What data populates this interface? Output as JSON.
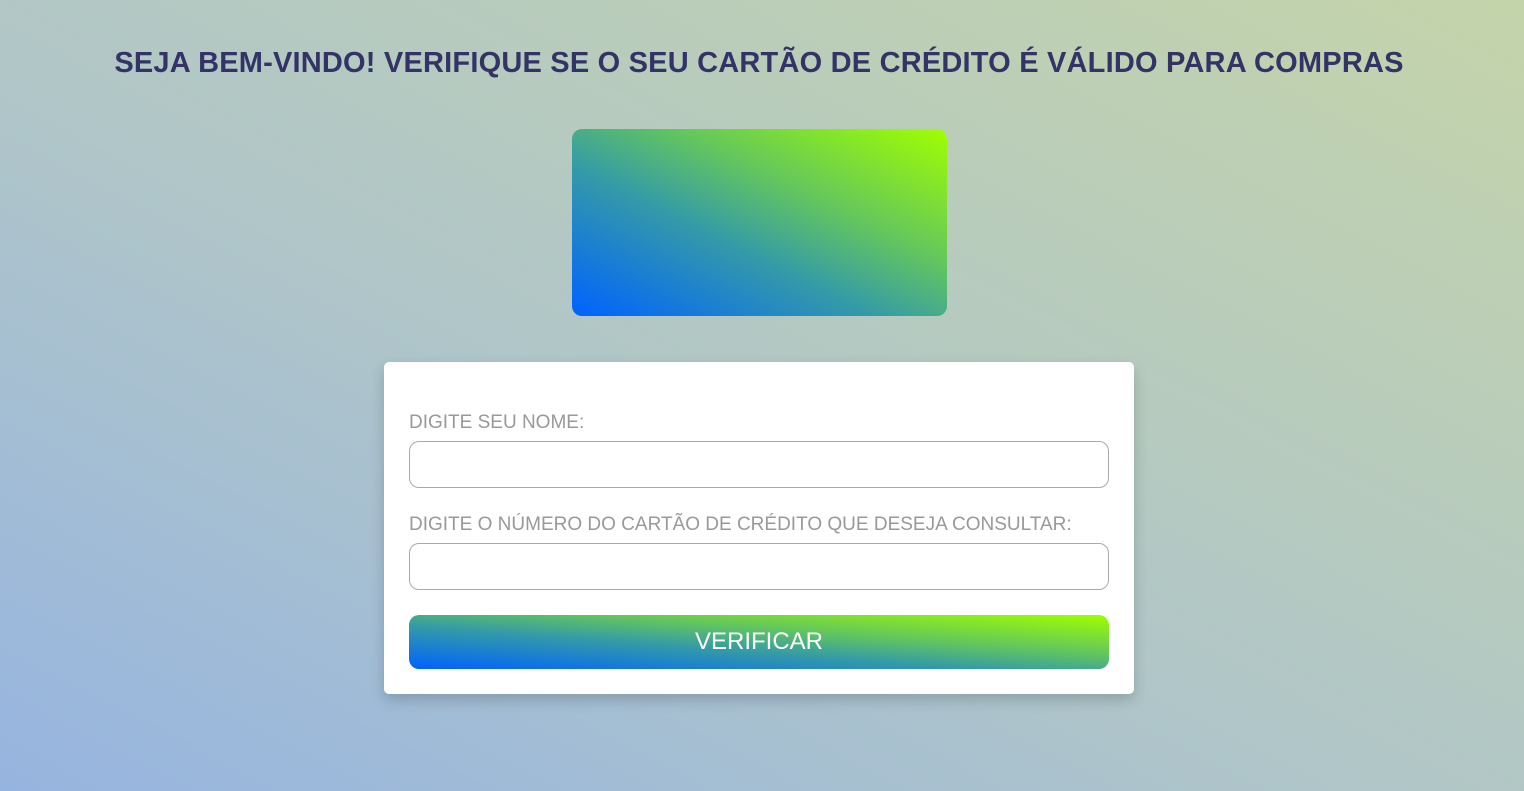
{
  "header": {
    "title": "SEJA BEM-VINDO! VERIFIQUE SE O SEU CARTÃO DE CRÉDITO É VÁLIDO PARA COMPRAS"
  },
  "form": {
    "name_label": "DIGITE SEU NOME:",
    "name_value": "",
    "card_label": "DIGITE O NÚMERO DO CARTÃO DE CRÉDITO QUE DESEJA CONSULTAR:",
    "card_value": "",
    "submit_label": "VERIFICAR"
  },
  "colors": {
    "title": "#333366",
    "gradient_start": "#0062ff",
    "gradient_end": "#a0ff00"
  }
}
